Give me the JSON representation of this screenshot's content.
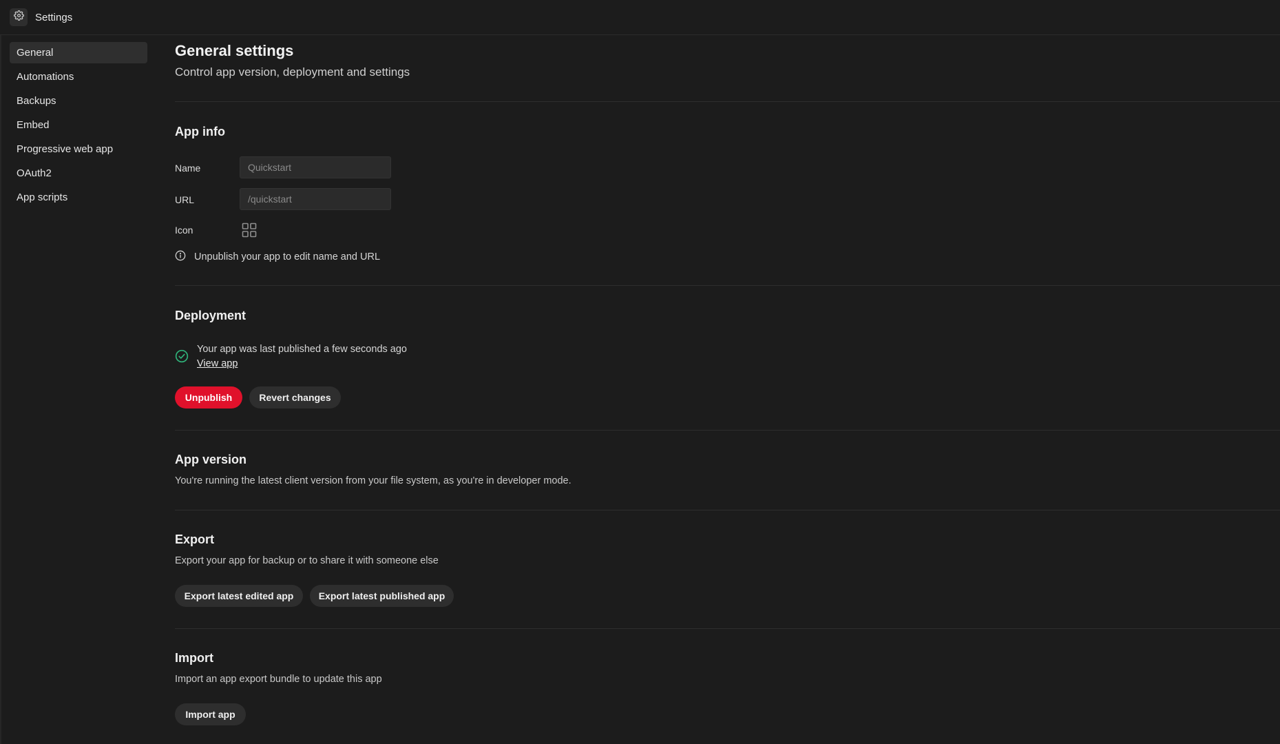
{
  "header": {
    "title": "Settings",
    "icon": "gear-icon"
  },
  "sidebar": {
    "items": [
      {
        "label": "General",
        "active": true
      },
      {
        "label": "Automations"
      },
      {
        "label": "Backups"
      },
      {
        "label": "Embed"
      },
      {
        "label": "Progressive web app"
      },
      {
        "label": "OAuth2"
      },
      {
        "label": "App scripts"
      }
    ]
  },
  "page": {
    "title": "General settings",
    "subtitle": "Control app version, deployment and settings"
  },
  "app_info": {
    "heading": "App info",
    "name_label": "Name",
    "name_placeholder": "Quickstart",
    "url_label": "URL",
    "url_placeholder": "/quickstart",
    "icon_label": "Icon",
    "icon_value": "grid-icon",
    "info_text": "Unpublish your app to edit name and URL"
  },
  "deployment": {
    "heading": "Deployment",
    "status_text": "Your app was last published a few seconds ago",
    "view_link": "View app",
    "unpublish_label": "Unpublish",
    "revert_label": "Revert changes",
    "accent": "#e0112b",
    "success_color": "#2fb37a"
  },
  "app_version": {
    "heading": "App version",
    "text": "You're running the latest client version from your file system, as you're in developer mode."
  },
  "export": {
    "heading": "Export",
    "text": "Export your app for backup or to share it with someone else",
    "edited_label": "Export latest edited app",
    "published_label": "Export latest published app"
  },
  "import": {
    "heading": "Import",
    "text": "Import an app export bundle to update this app",
    "button_label": "Import app"
  }
}
